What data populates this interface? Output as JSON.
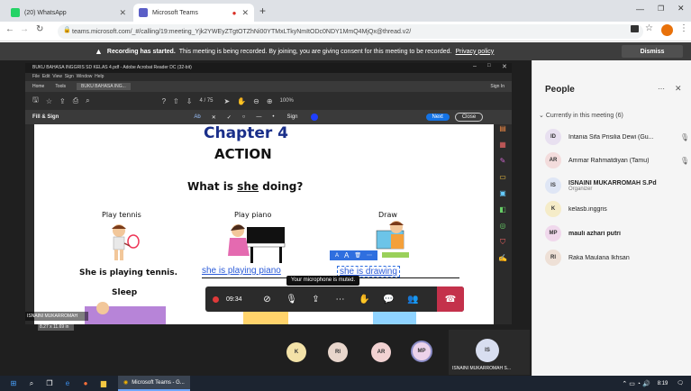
{
  "browser": {
    "tabs": [
      {
        "label": "(20) WhatsApp",
        "icon": "whatsapp-icon",
        "color": "#25d366"
      },
      {
        "label": "Microsoft Teams",
        "icon": "teams-icon",
        "color": "#5b5fc7",
        "recording": true
      }
    ],
    "new_tab": "+",
    "address": "teams.microsoft.com/_#/calling/19:meeting_Yjk2YWEyZTgtOTZhNi00YTMxLTkyNmItODc0NDY1MmQ4MjQx@thread.v2/"
  },
  "banner": {
    "title": "Recording has started.",
    "text": "This meeting is being recorded. By joining, you are giving consent for this meeting to be recorded.",
    "link": "Privacy policy",
    "dismiss": "Dismiss"
  },
  "shared": {
    "window_title": "BUKU BAHASA INGGRIS SD KELAS 4.pdf - Adobe Acrobat Reader DC (32-bit)",
    "menu": [
      "File",
      "Edit",
      "View",
      "Sign",
      "Window",
      "Help"
    ],
    "tabs": [
      "Home",
      "Tools",
      "BUKU BAHASA ING..."
    ],
    "sign_in": "Sign In",
    "page_indicator": "4 / 75",
    "zoom": "100%",
    "fill_sign_label": "Fill & Sign",
    "sign_label": "Sign",
    "next_button": "Next",
    "close_button": "Close",
    "page": {
      "chapter": "Chapter 4",
      "heading": "ACTION",
      "question_pre": "What is ",
      "question_word": "she",
      "question_post": " doing?",
      "items": [
        {
          "label": "Play tennis",
          "sentence": "She is playing tennis."
        },
        {
          "label": "Play piano",
          "typed": "she is playing piano"
        },
        {
          "label": "Draw",
          "typed": "she is drawing"
        }
      ],
      "next_label": "Sleep",
      "size_readout": "8.27 x 11.69 in"
    },
    "presenter": "ISNAINI MUKARROMAH"
  },
  "controls": {
    "timer": "09:34",
    "mute_tooltip": "Your microphone is muted."
  },
  "gallery": {
    "avatars": [
      "K",
      "RI",
      "AR",
      "MP"
    ],
    "self_initials": "IS",
    "self_name": "ISNAINI MUKARROMAH S..."
  },
  "people": {
    "title": "People",
    "section": "Currently in this meeting (6)",
    "members": [
      {
        "initials": "ID",
        "name": "Intania Sifa Prisilia Dewi (Gu...",
        "color": "#e8e0f0"
      },
      {
        "initials": "AR",
        "name": "Ammar Rahmatdiyan (Tamu)",
        "color": "#f3dcdc"
      },
      {
        "initials": "IS",
        "name": "ISNAINI MUKARROMAH S.Pd",
        "role": "Organizer",
        "color": "#dfe6f5"
      },
      {
        "initials": "K",
        "name": "kelasb.inggris",
        "color": "#f5ecc8"
      },
      {
        "initials": "MP",
        "name": "mauli azhari putri",
        "color": "#f0d8ec"
      },
      {
        "initials": "RI",
        "name": "Raka Maulana Ikhsan",
        "color": "#eee0d6"
      }
    ]
  },
  "taskbar": {
    "app_label": "Microsoft Teams - G...",
    "time": "8:19"
  }
}
